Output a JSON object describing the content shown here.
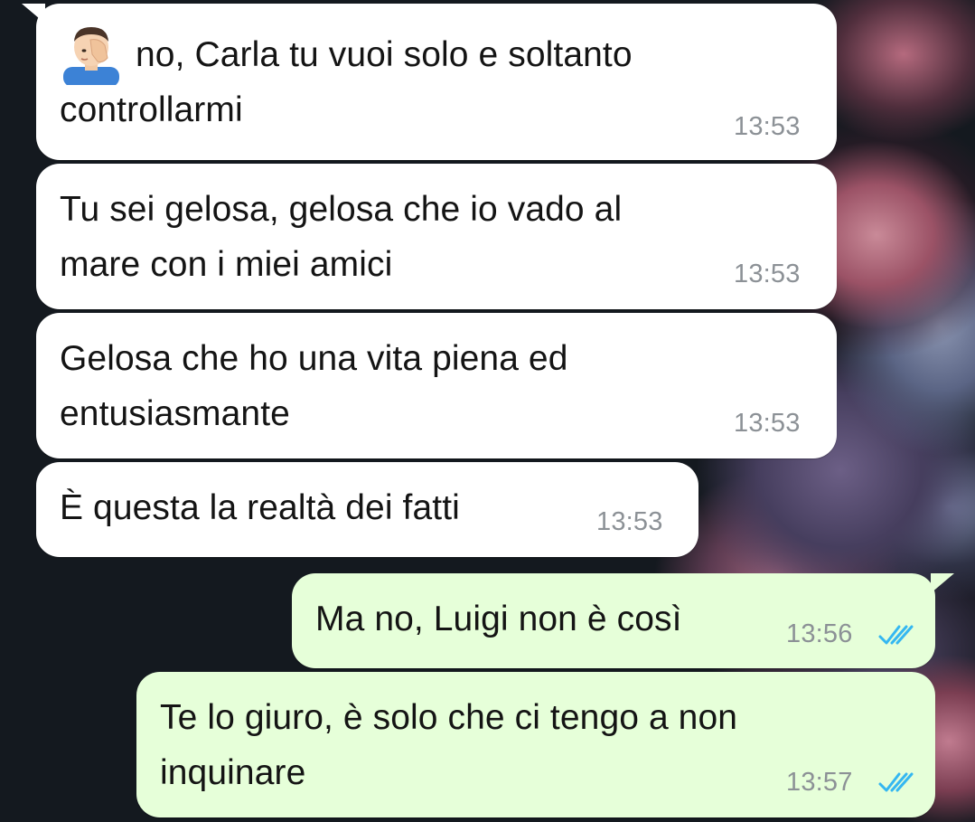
{
  "conversation": {
    "messages": [
      {
        "direction": "incoming",
        "emoji": "man-facepalming-emoji",
        "text": "no, Carla tu vuoi solo e soltanto\ncontrollarmi",
        "time": "13:53"
      },
      {
        "direction": "incoming",
        "text": "Tu sei gelosa, gelosa che io vado al\nmare con i miei amici",
        "time": "13:53"
      },
      {
        "direction": "incoming",
        "text": "Gelosa che ho una vita piena ed\nentusiasmante",
        "time": "13:53"
      },
      {
        "direction": "incoming",
        "text": "È questa la realtà dei fatti",
        "time": "13:53"
      },
      {
        "direction": "outgoing",
        "text": "Ma no, Luigi non è così",
        "time": "13:56",
        "status_icon": "double-check-read-icon"
      },
      {
        "direction": "outgoing",
        "text": "Te lo giuro, è solo che ci tengo a non\ninquinare",
        "time": "13:57",
        "status_icon": "double-check-read-icon"
      }
    ]
  },
  "colors": {
    "incoming_bubble": "#ffffff",
    "outgoing_bubble": "#e6ffd9",
    "read_ticks": "#34b7f1",
    "timestamp": "#8c9196"
  }
}
